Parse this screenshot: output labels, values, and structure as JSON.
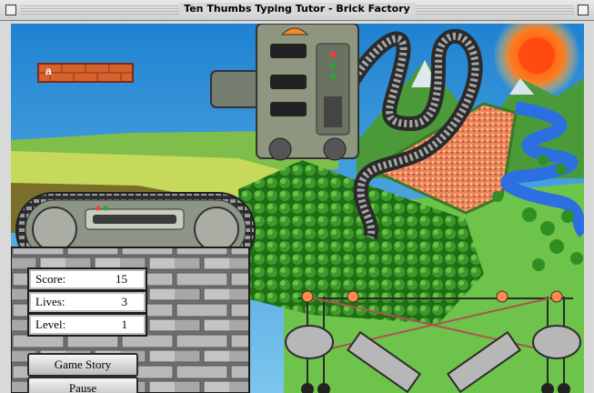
{
  "window": {
    "title": "Ten Thumbs Typing Tutor - Brick Factory"
  },
  "stats": {
    "score": {
      "label": "Score:",
      "value": "15"
    },
    "lives": {
      "label": "Lives:",
      "value": "3"
    },
    "level": {
      "label": "Level:",
      "value": "1"
    }
  },
  "buttons": {
    "story": "Game Story",
    "pause": "Pause"
  },
  "brick_sign": {
    "letter": "a"
  },
  "colors": {
    "sky": "#3f9ad9",
    "grass": "#6ec34a",
    "forest": "#2e8b20",
    "river": "#2b6fe0",
    "sun": "#ff5a16"
  }
}
